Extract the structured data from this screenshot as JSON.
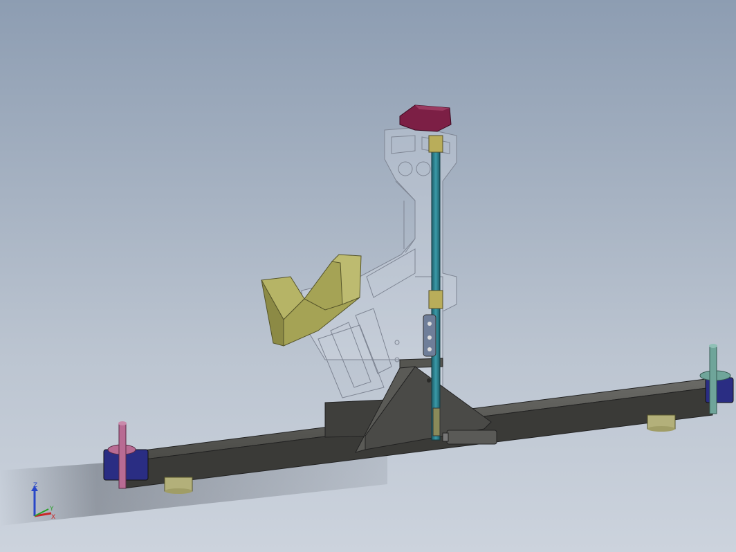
{
  "window": {
    "background_top": "#8d9db2",
    "background_bottom": "#ccd3dd"
  },
  "model": {
    "parts": [
      {
        "name": "base-beam",
        "color": "#3e3e3b"
      },
      {
        "name": "upright-bracket",
        "color": "#dfe3ea"
      },
      {
        "name": "saddle-support",
        "color": "#a5a355"
      },
      {
        "name": "top-clamp-block",
        "color": "#7c1f45"
      },
      {
        "name": "vertical-rod",
        "color": "#2a7a86"
      },
      {
        "name": "rod-bushing",
        "color": "#b9ad5a"
      },
      {
        "name": "end-cap-left",
        "color": "#2a2d83"
      },
      {
        "name": "end-cap-right",
        "color": "#2a2d83"
      },
      {
        "name": "locating-pin-left",
        "color": "#b86b93"
      },
      {
        "name": "locating-pin-right",
        "color": "#6fa59a"
      },
      {
        "name": "foot-pad",
        "color": "#b3b07a"
      },
      {
        "name": "gusset-plate",
        "color": "#4a4a47"
      },
      {
        "name": "pneumatic-cylinder",
        "color": "#555555"
      }
    ]
  },
  "triad": {
    "z_label": "Z",
    "x_label": "X",
    "y_label": "Y",
    "z_color": "#2846c8",
    "x_color": "#c82828",
    "y_color": "#28a028"
  }
}
